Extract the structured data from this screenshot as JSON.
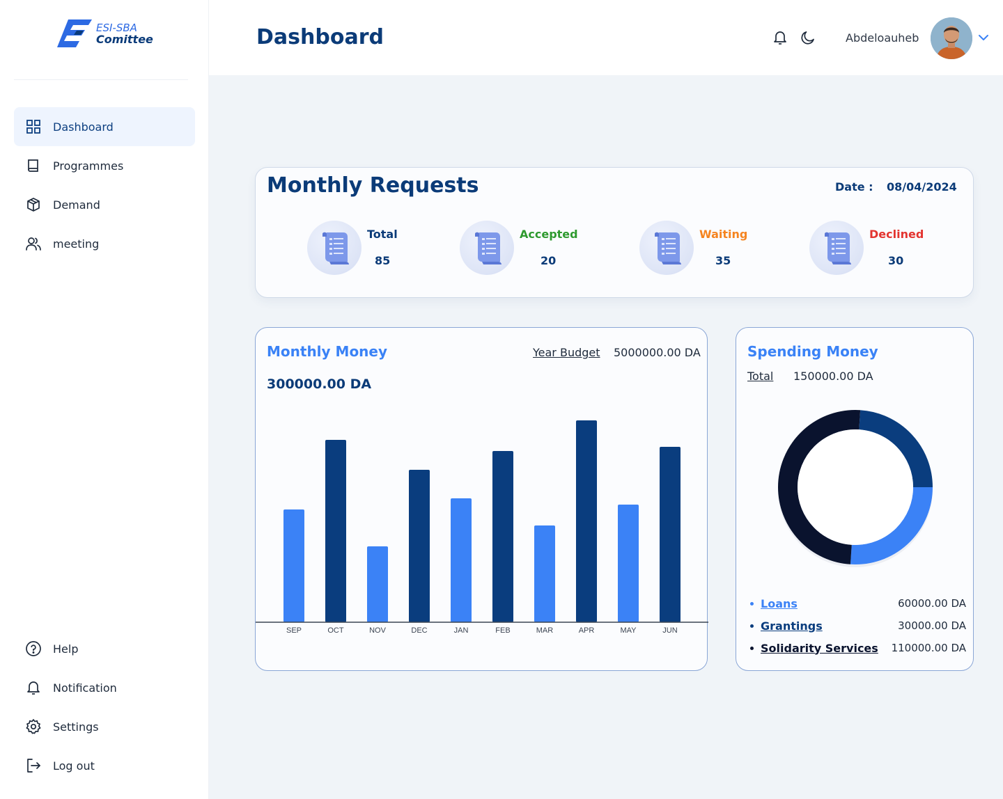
{
  "app": {
    "logo_top": "ESI-SBA",
    "logo_bottom": "Comittee"
  },
  "sidebar": {
    "items": [
      {
        "label": "Dashboard",
        "icon": "grid-icon",
        "active": true
      },
      {
        "label": "Programmes",
        "icon": "book-icon"
      },
      {
        "label": "Demand",
        "icon": "box-icon"
      },
      {
        "label": "meeting",
        "icon": "users-icon"
      }
    ],
    "bottom": [
      {
        "label": "Help",
        "icon": "help-icon"
      },
      {
        "label": "Notification",
        "icon": "bell-icon"
      },
      {
        "label": "Settings",
        "icon": "gear-icon"
      },
      {
        "label": "Log out",
        "icon": "logout-icon"
      }
    ]
  },
  "header": {
    "title": "Dashboard",
    "username": "Abdeloauheb"
  },
  "requests": {
    "title": "Monthly Requests",
    "date_label": "Date :",
    "date": "08/04/2024",
    "stats": [
      {
        "label": "Total",
        "value": "85",
        "color": "#0b3b78"
      },
      {
        "label": "Accepted",
        "value": "20",
        "color": "#2e9a2e"
      },
      {
        "label": "Waiting",
        "value": "35",
        "color": "#f5841f"
      },
      {
        "label": "Declined",
        "value": "30",
        "color": "#e3342f"
      }
    ]
  },
  "money": {
    "title": "Monthly Money",
    "year_budget_label": "Year Budget",
    "year_budget_value": "5000000.00 DA",
    "total": "300000.00 DA"
  },
  "chart_data": {
    "type": "bar",
    "categories": [
      "SEP",
      "OCT",
      "NOV",
      "DEC",
      "JAN",
      "FEB",
      "MAR",
      "APR",
      "MAY",
      "JUN"
    ],
    "values": [
      162,
      262,
      109,
      219,
      178,
      246,
      139,
      290,
      169,
      252
    ],
    "colors": [
      "#3b82f6",
      "#0a3d7e"
    ],
    "ylim": [
      0,
      300
    ]
  },
  "spending": {
    "title": "Spending Money",
    "total_label": "Total",
    "total_value": "150000.00 DA",
    "items": [
      {
        "name": "Loans",
        "value": "60000.00 DA",
        "color": "#3b82f6"
      },
      {
        "name": "Grantings",
        "value": "30000.00 DA",
        "color": "#0a3d7e"
      },
      {
        "name": "Solidarity Services",
        "value": "110000.00 DA",
        "color": "#0a132e"
      }
    ],
    "donut_fractions": [
      0.26,
      0.24,
      0.5
    ]
  }
}
